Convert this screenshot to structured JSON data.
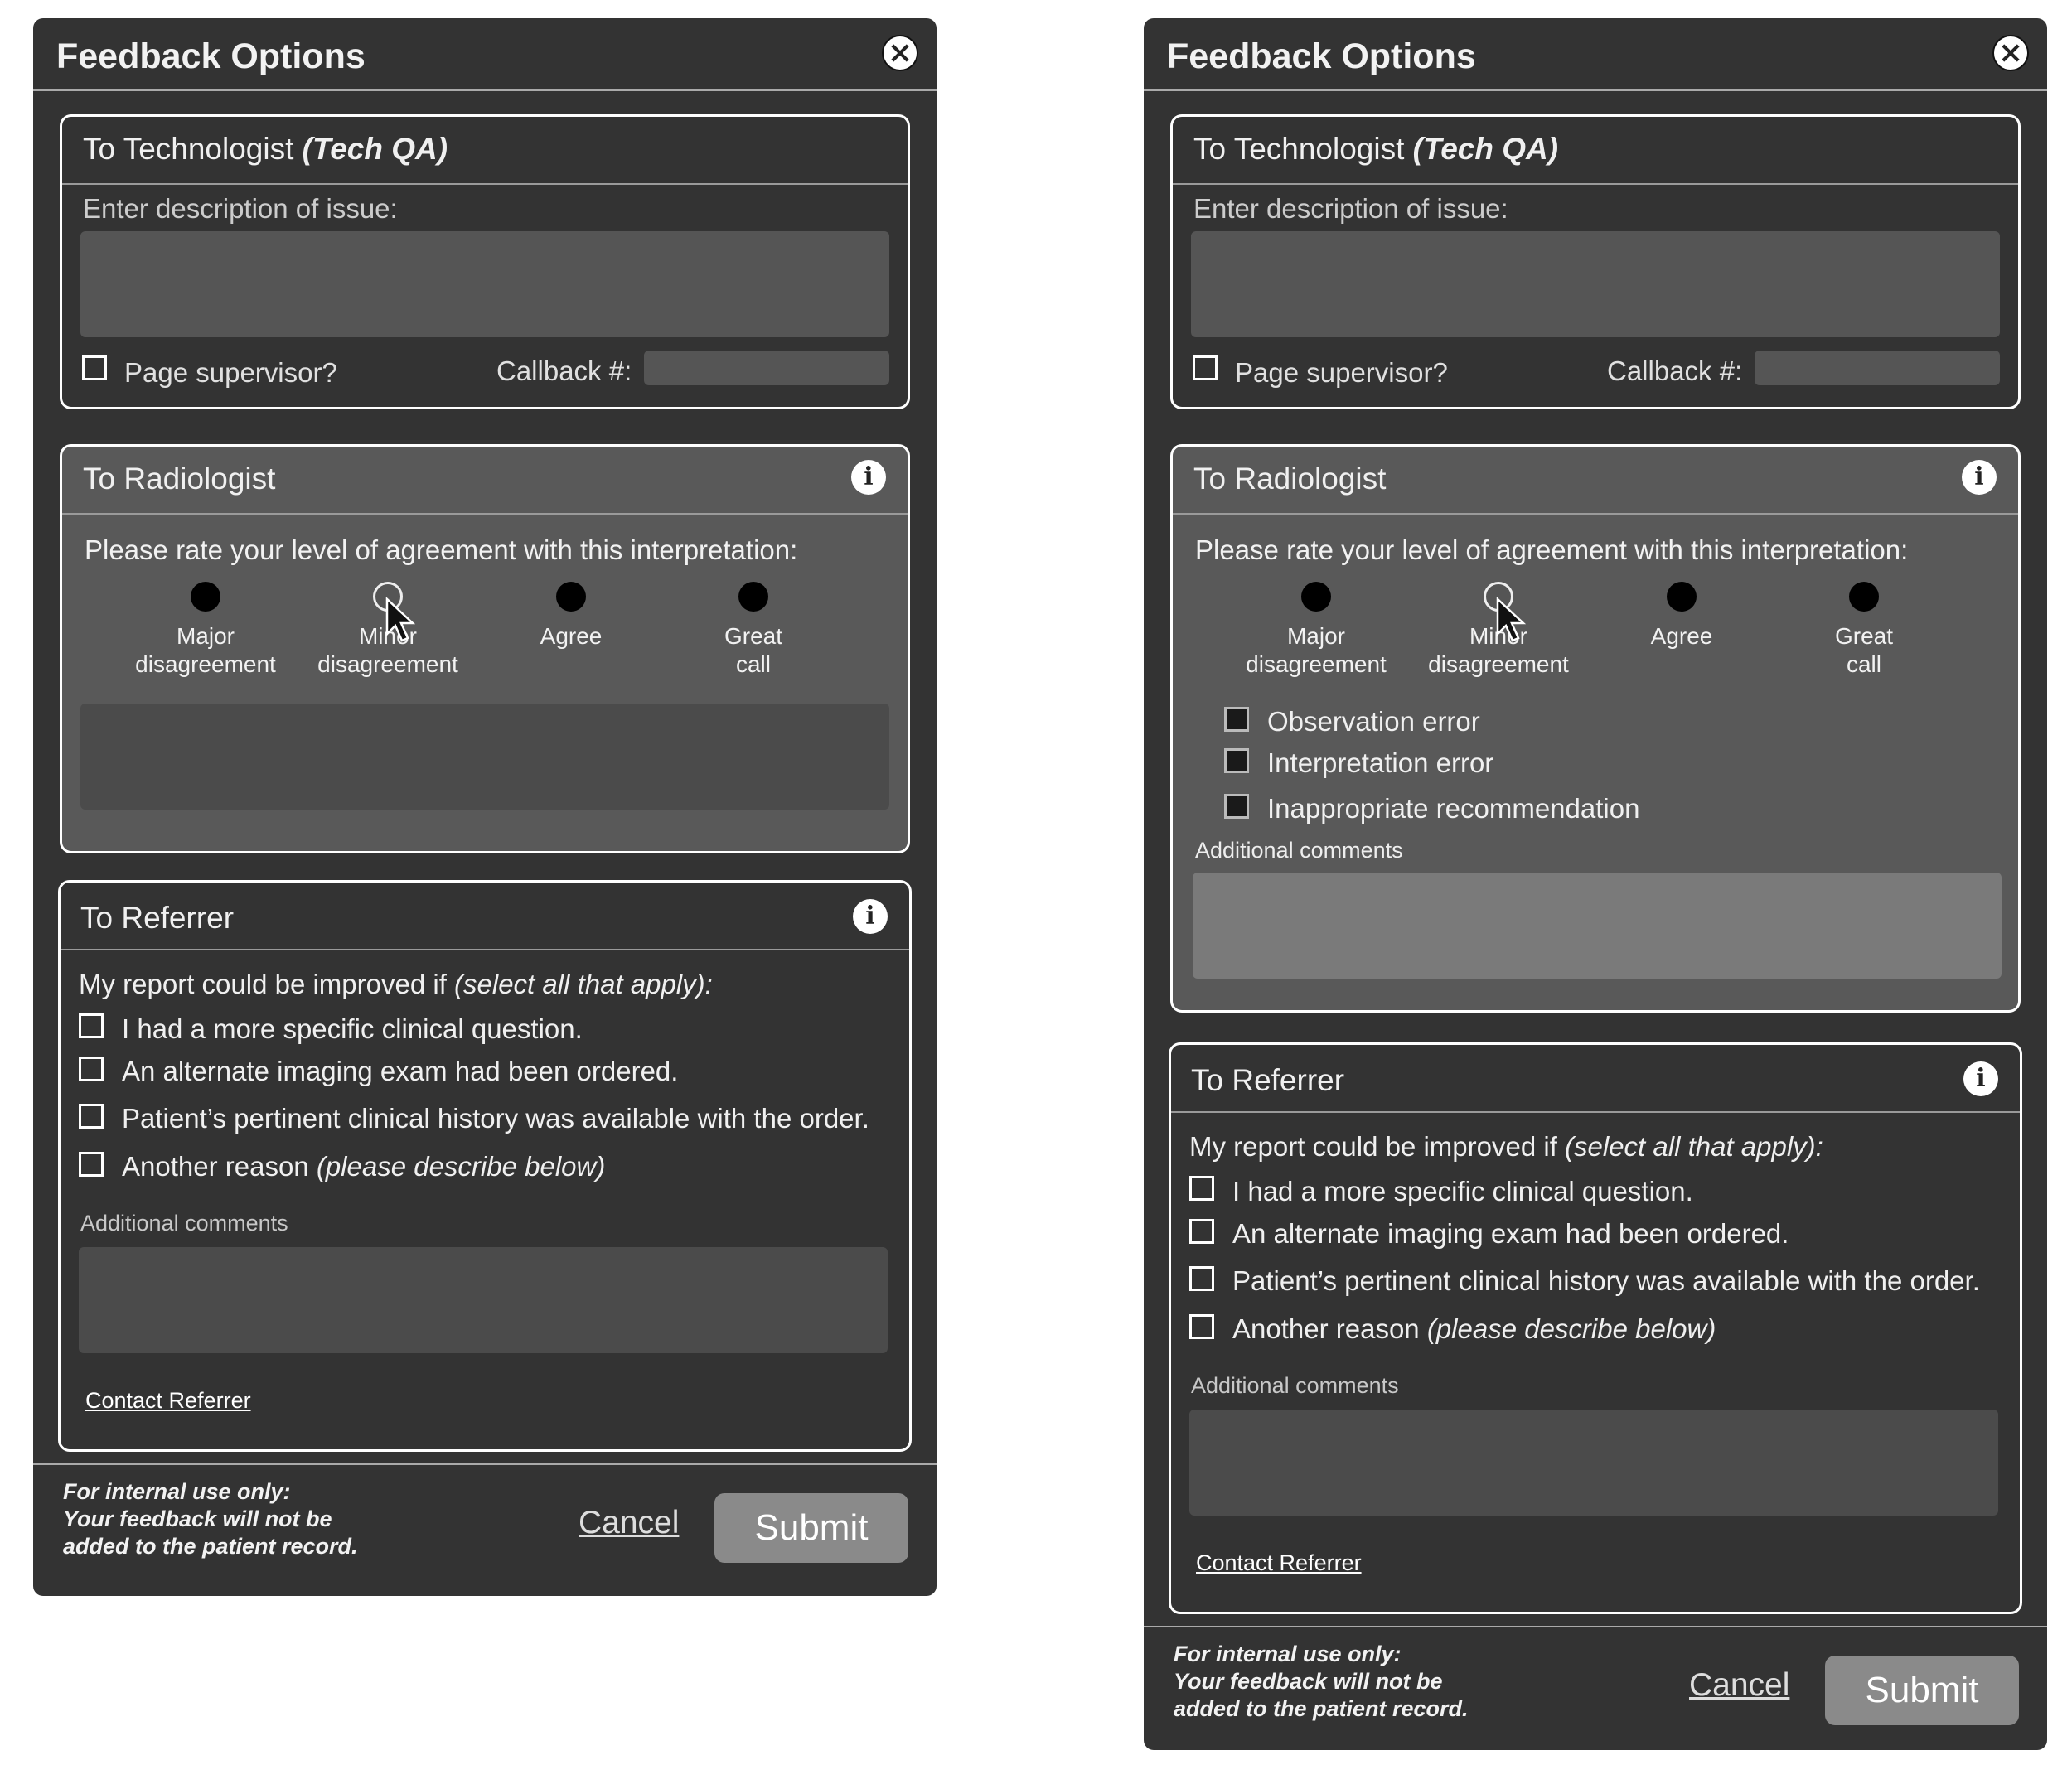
{
  "dialog": {
    "title": "Feedback Options"
  },
  "tech": {
    "title": "To Technologist",
    "title_em": "(Tech QA)",
    "desc_label": "Enter description of issue:",
    "page_supervisor": "Page supervisor?",
    "callback_label": "Callback #:"
  },
  "radiologist": {
    "title": "To Radiologist",
    "prompt": "Please rate your level of agreement with this interpretation:",
    "options": [
      {
        "line1": "Major",
        "line2": "disagreement"
      },
      {
        "line1": "Minor",
        "line2": "disagreement"
      },
      {
        "line1": "Agree",
        "line2": ""
      },
      {
        "line1": "Great",
        "line2": "call"
      }
    ],
    "selected_index": 1,
    "errors": [
      "Observation error",
      "Interpretation error",
      "Inappropriate recommendation"
    ],
    "additional_comments": "Additional comments"
  },
  "referrer": {
    "title": "To Referrer",
    "prompt": "My report could be improved if",
    "prompt_em": "(select all that apply):",
    "items": [
      "I had a more specific clinical question.",
      "An alternate imaging exam had been ordered.",
      "Patient’s pertinent clinical history was available with the order."
    ],
    "another": "Another reason",
    "another_em": "(please describe below)",
    "additional_comments": "Additional comments",
    "contact": "Contact Referrer"
  },
  "footer": {
    "note_line1": "For internal use only:",
    "note_line2": "Your feedback will not be",
    "note_line3": "added to the patient record.",
    "cancel": "Cancel",
    "submit": "Submit"
  },
  "colors": {
    "dialog_bg": "#333333",
    "radiologist_bg": "#595959",
    "submit_bg": "#8a8a8a"
  }
}
